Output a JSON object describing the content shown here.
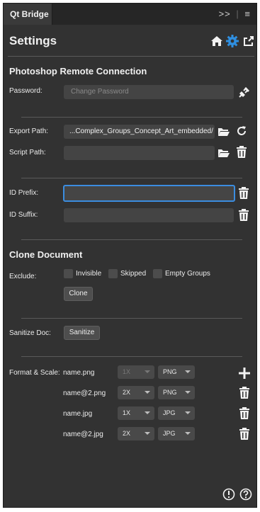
{
  "tab": {
    "title": "Qt Bridge",
    "right_chevron": ">>",
    "menu_icon": "menu-icon"
  },
  "header": {
    "title": "Settings",
    "icons": [
      "home-icon",
      "gear-icon",
      "export-icon"
    ],
    "accent": "#2f8fe0"
  },
  "remote": {
    "section": "Photoshop Remote Connection",
    "password_label": "Password:",
    "password_placeholder": "Change Password"
  },
  "paths": {
    "export_label": "Export Path:",
    "export_value": "...Complex_Groups_Concept_Art_embedded/",
    "script_label": "Script Path:",
    "script_value": ""
  },
  "ids": {
    "prefix_label": "ID Prefix:",
    "prefix_value": "",
    "suffix_label": "ID Suffix:",
    "suffix_value": ""
  },
  "clone": {
    "section": "Clone Document",
    "exclude_label": "Exclude:",
    "options": [
      "Invisible",
      "Skipped",
      "Empty Groups"
    ],
    "button": "Clone"
  },
  "sanitize": {
    "label": "Sanitize Doc:",
    "button": "Sanitize"
  },
  "format": {
    "label": "Format & Scale:",
    "rows": [
      {
        "name": "name.png",
        "scale": "1X",
        "format": "PNG",
        "scale_disabled": true,
        "action": "plus"
      },
      {
        "name": "name@2.png",
        "scale": "2X",
        "format": "PNG",
        "scale_disabled": false,
        "action": "trash"
      },
      {
        "name": "name.jpg",
        "scale": "1X",
        "format": "JPG",
        "scale_disabled": false,
        "action": "trash"
      },
      {
        "name": "name@2.jpg",
        "scale": "2X",
        "format": "JPG",
        "scale_disabled": false,
        "action": "trash"
      }
    ]
  },
  "footer": {
    "icons": [
      "info-icon",
      "help-icon"
    ]
  }
}
